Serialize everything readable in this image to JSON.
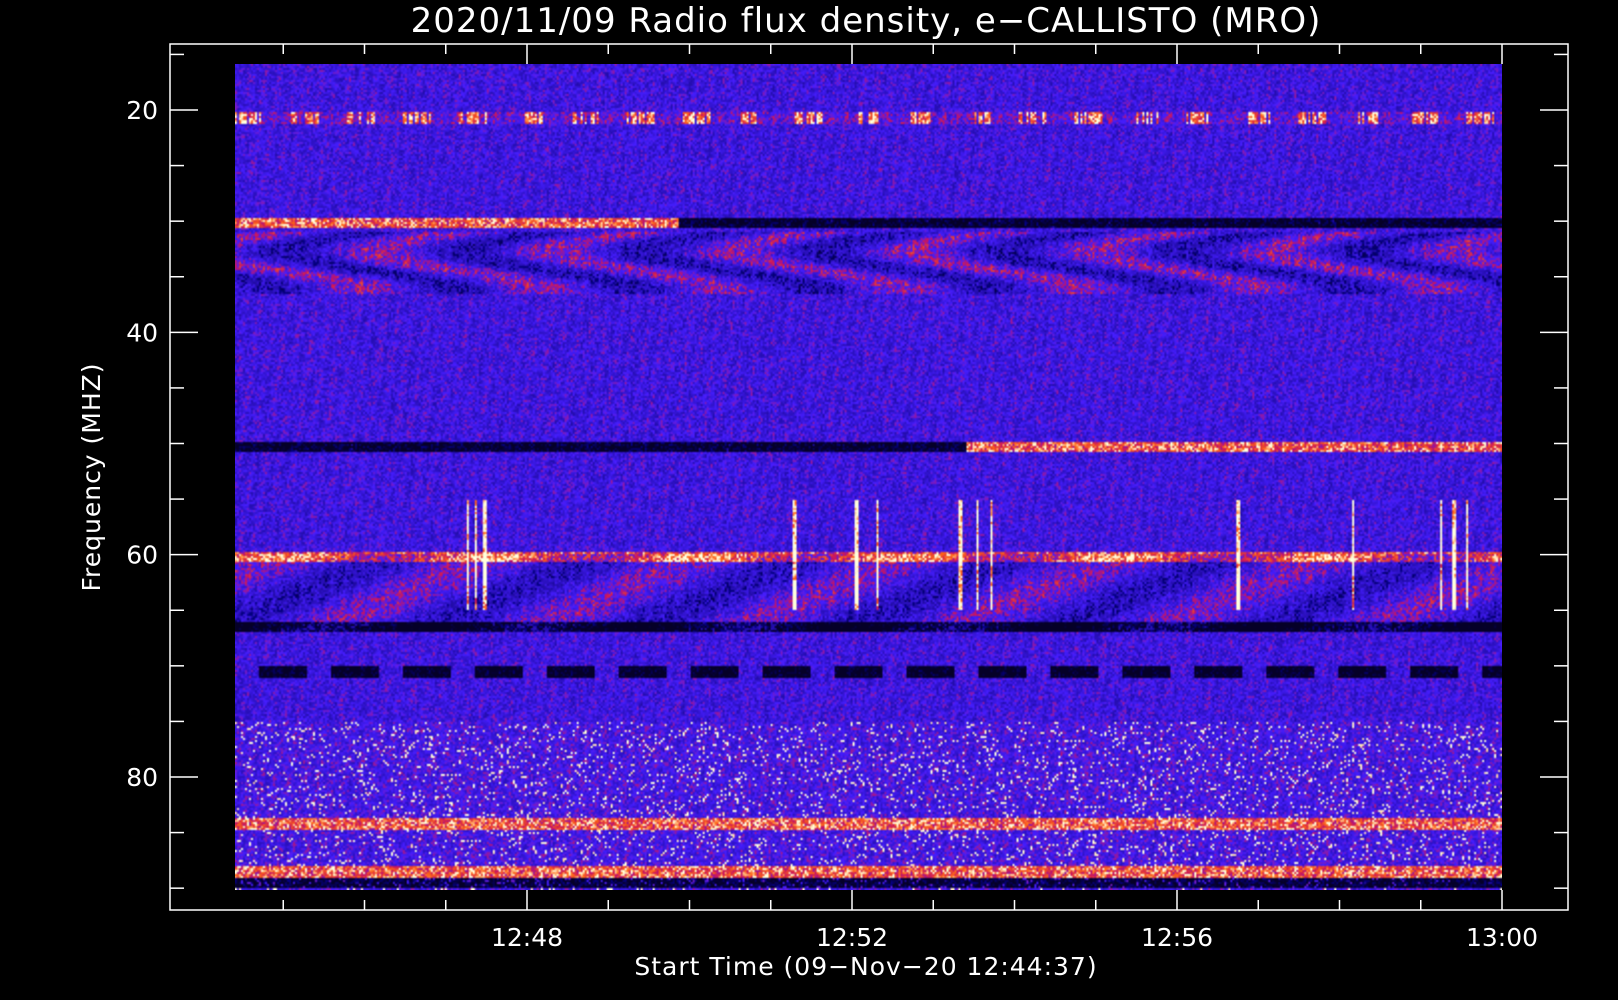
{
  "chart_data": {
    "type": "heatmap",
    "title": "2020/11/09  Radio flux density, e−CALLISTO (MRO)",
    "xlabel": "Start Time (09−Nov−20 12:44:37)",
    "ylabel": "Frequency (MHZ)",
    "y_axis_inverted": true,
    "ylim": [
      92,
      14
    ],
    "y_data_range": [
      16,
      90
    ],
    "x_range_seconds_after_12_48": [
      -203,
      720
    ],
    "x_ticks": [
      {
        "label": "12:48",
        "seconds": 0
      },
      {
        "label": "12:52",
        "seconds": 240
      },
      {
        "label": "12:56",
        "seconds": 480
      },
      {
        "label": "13:00",
        "seconds": 720
      }
    ],
    "y_ticks": [
      {
        "label": "20",
        "value": 20
      },
      {
        "label": "40",
        "value": 40
      },
      {
        "label": "60",
        "value": 60
      },
      {
        "label": "80",
        "value": 80
      }
    ],
    "x_minor_tick_seconds": [
      -180,
      -120,
      -60,
      60,
      120,
      180,
      300,
      360,
      420,
      540,
      600,
      660
    ],
    "y_minor_tick_values": [
      15,
      25,
      30,
      35,
      45,
      50,
      55,
      65,
      70,
      75,
      85,
      90
    ],
    "colormap": [
      "#000000",
      "#0c0040",
      "#2a10c8",
      "#3a20f0",
      "#6a2090",
      "#c02810",
      "#ff5020",
      "#ffd060",
      "#ffffff"
    ],
    "dominant_color": "#3a20f0",
    "emission_lines_mhz": [
      {
        "freq": 20.8,
        "kind": "dashed-bright"
      },
      {
        "freq": 30.2,
        "kind": "bright-dark-split"
      },
      {
        "freq": 50.3,
        "kind": "dark-bright-split"
      },
      {
        "freq": 60.2,
        "kind": "bright"
      },
      {
        "freq": 66.5,
        "kind": "dark"
      },
      {
        "freq": 70.5,
        "kind": "dashed-dark"
      },
      {
        "freq": 84.2,
        "kind": "bright"
      },
      {
        "freq": 88.5,
        "kind": "bright"
      },
      {
        "freq": 89.5,
        "kind": "dark"
      }
    ],
    "bursts_seconds": [
      -34,
      -28,
      -21,
      205,
      250,
      265,
      326,
      338,
      348,
      528,
      612,
      676,
      686,
      695
    ]
  }
}
